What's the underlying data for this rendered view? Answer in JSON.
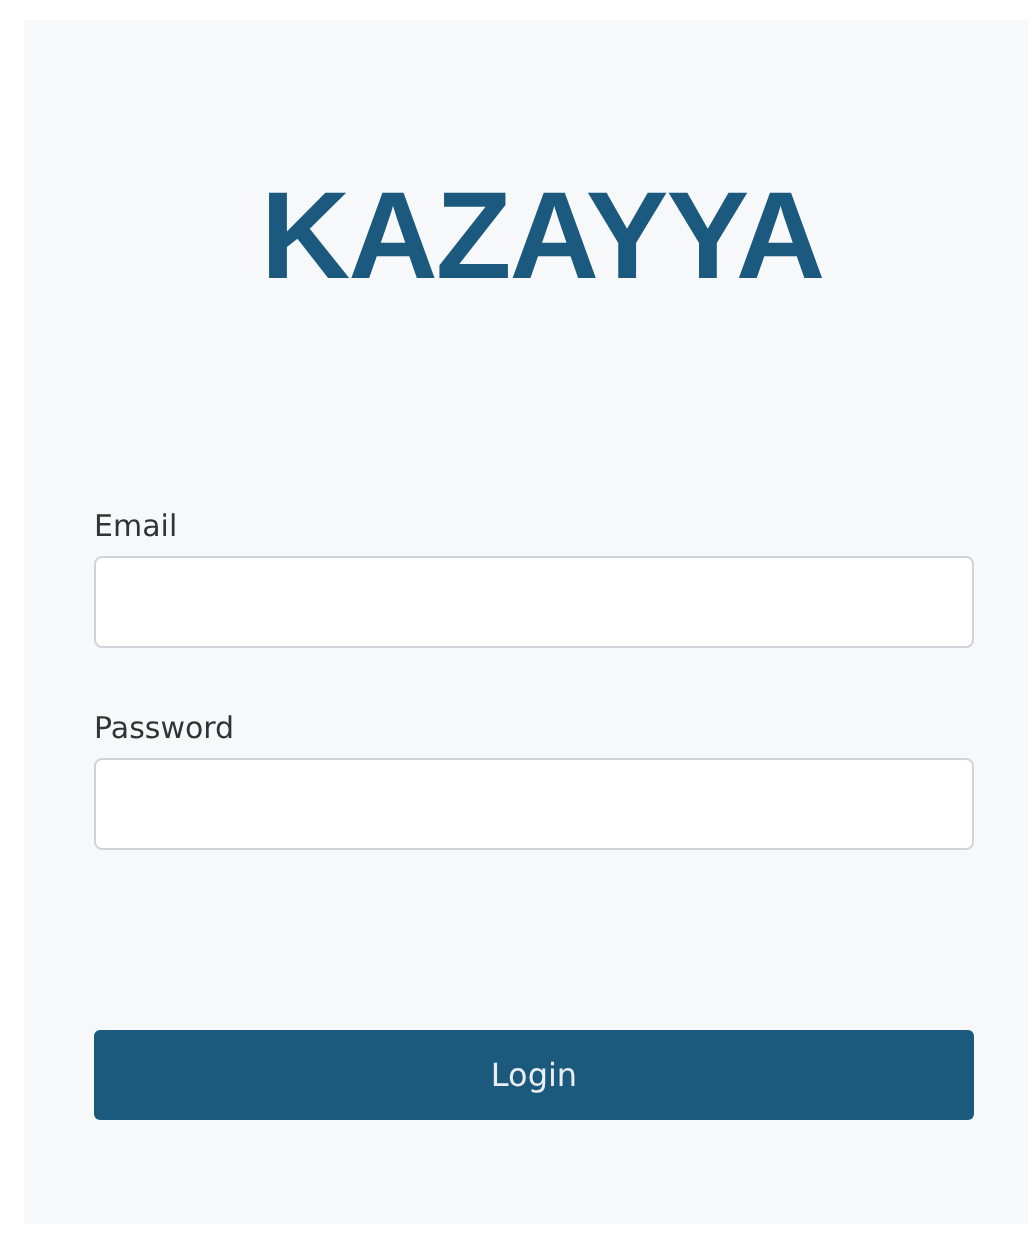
{
  "logo": "KAZAYYA",
  "fields": [
    {
      "label": "Email"
    },
    {
      "label": "Password"
    }
  ],
  "button": "Login"
}
